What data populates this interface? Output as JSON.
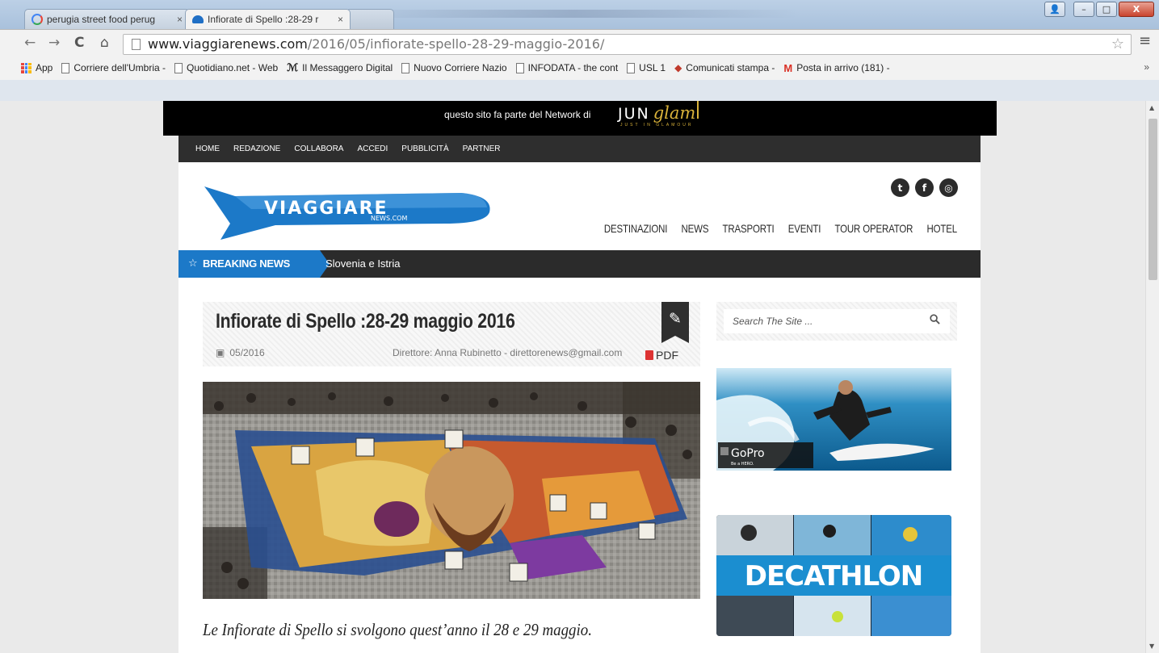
{
  "browser": {
    "tabs": [
      {
        "label": "perugia street food perug",
        "close": "×"
      },
      {
        "label": "Infiorate di Spello :28-29 r",
        "close": "×"
      }
    ],
    "url_host": "www.viaggiarenews.com",
    "url_path": "/2016/05/infiorate-spello-28-29-maggio-2016/",
    "nav": {
      "back": "←",
      "forward": "→",
      "reload": "C",
      "home": "⌂"
    },
    "menu": "≡",
    "star": "☆",
    "window_buttons": {
      "user": "👤",
      "minimize": "–",
      "maximize": "□",
      "close": "X"
    }
  },
  "bookmarks": [
    {
      "label": "App"
    },
    {
      "label": "Corriere dell'Umbria -"
    },
    {
      "label": "Quotidiano.net - Web"
    },
    {
      "label": "Il Messaggero Digital"
    },
    {
      "label": "Nuovo Corriere Nazio"
    },
    {
      "label": "INFODATA - the cont"
    },
    {
      "label": "USL 1"
    },
    {
      "label": "Comunicati stampa -"
    },
    {
      "label": "Posta in arrivo (181) -"
    }
  ],
  "bookmarks_more": "»",
  "network_bar": {
    "text": "questo sito fa parte del Network di",
    "logo_main": "JUN",
    "logo_script": "glam",
    "logo_sub": "JUST IN GLAMOUR"
  },
  "top_nav": [
    "HOME",
    "REDAZIONE",
    "COLLABORA",
    "ACCEDI",
    "PUBBLICITÀ",
    "PARTNER"
  ],
  "logo": {
    "main": "VIAGGIARE",
    "sub": "NEWS.COM"
  },
  "social": [
    {
      "icon": "twitter-icon",
      "glyph": "t"
    },
    {
      "icon": "facebook-icon",
      "glyph": "f"
    },
    {
      "icon": "instagram-icon",
      "glyph": "◎"
    }
  ],
  "main_nav": [
    "DESTINAZIONI",
    "NEWS",
    "TRASPORTI",
    "EVENTI",
    "TOUR OPERATOR",
    "HOTEL"
  ],
  "breaking": {
    "label": "BREAKING NEWS",
    "ticker": "Slovenia e Istria"
  },
  "post": {
    "title": "Infiorate di Spello :28-29 maggio 2016",
    "date": "05/2016",
    "author": "Direttore: Anna Rubinetto - direttorenews@gmail.com",
    "pdf": "PDF",
    "caption": "Le Infiorate di Spello  si svolgono quest’anno il  28 e 29 maggio."
  },
  "search": {
    "placeholder": "Search The Site ..."
  },
  "ads": {
    "gopro": {
      "brand": "GoPro",
      "tag": "Be a HERO."
    },
    "decathlon": {
      "brand": "DECATHLON"
    }
  },
  "colors": {
    "accent_blue": "#1c79c8",
    "dark_nav": "#2e2e2e",
    "gold": "#d9b23a"
  }
}
